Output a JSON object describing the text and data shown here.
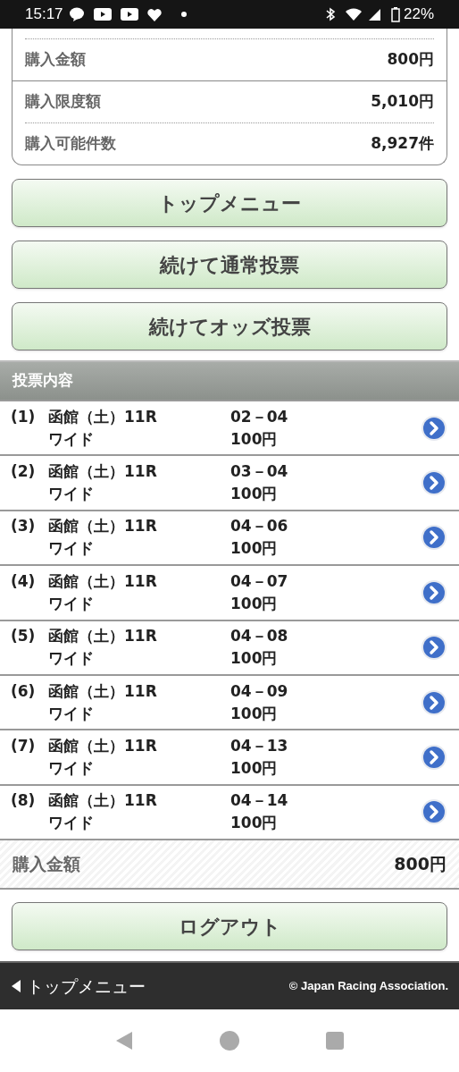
{
  "status_bar": {
    "time": "15:17",
    "battery": "22%"
  },
  "summary": [
    {
      "label": "購入金額",
      "value": "800円"
    },
    {
      "label": "購入限度額",
      "value": "5,010円"
    },
    {
      "label": "購入可能件数",
      "value": "8,927件"
    }
  ],
  "buttons": [
    "トップメニュー",
    "続けて通常投票",
    "続けてオッズ投票"
  ],
  "section_title": "投票内容",
  "bets": [
    {
      "index": "(1)",
      "race": "函館（土）11R",
      "type": "ワイド",
      "combo": "02－04",
      "amount": "100円"
    },
    {
      "index": "(2)",
      "race": "函館（土）11R",
      "type": "ワイド",
      "combo": "03－04",
      "amount": "100円"
    },
    {
      "index": "(3)",
      "race": "函館（土）11R",
      "type": "ワイド",
      "combo": "04－06",
      "amount": "100円"
    },
    {
      "index": "(4)",
      "race": "函館（土）11R",
      "type": "ワイド",
      "combo": "04－07",
      "amount": "100円"
    },
    {
      "index": "(5)",
      "race": "函館（土）11R",
      "type": "ワイド",
      "combo": "04－08",
      "amount": "100円"
    },
    {
      "index": "(6)",
      "race": "函館（土）11R",
      "type": "ワイド",
      "combo": "04－09",
      "amount": "100円"
    },
    {
      "index": "(7)",
      "race": "函館（土）11R",
      "type": "ワイド",
      "combo": "04－13",
      "amount": "100円"
    },
    {
      "index": "(8)",
      "race": "函館（土）11R",
      "type": "ワイド",
      "combo": "04－14",
      "amount": "100円"
    }
  ],
  "total": {
    "label": "購入金額",
    "value": "800円"
  },
  "logout_button": "ログアウト",
  "footer": {
    "back_link": "トップメニュー",
    "copyright": "© Japan Racing Association."
  }
}
